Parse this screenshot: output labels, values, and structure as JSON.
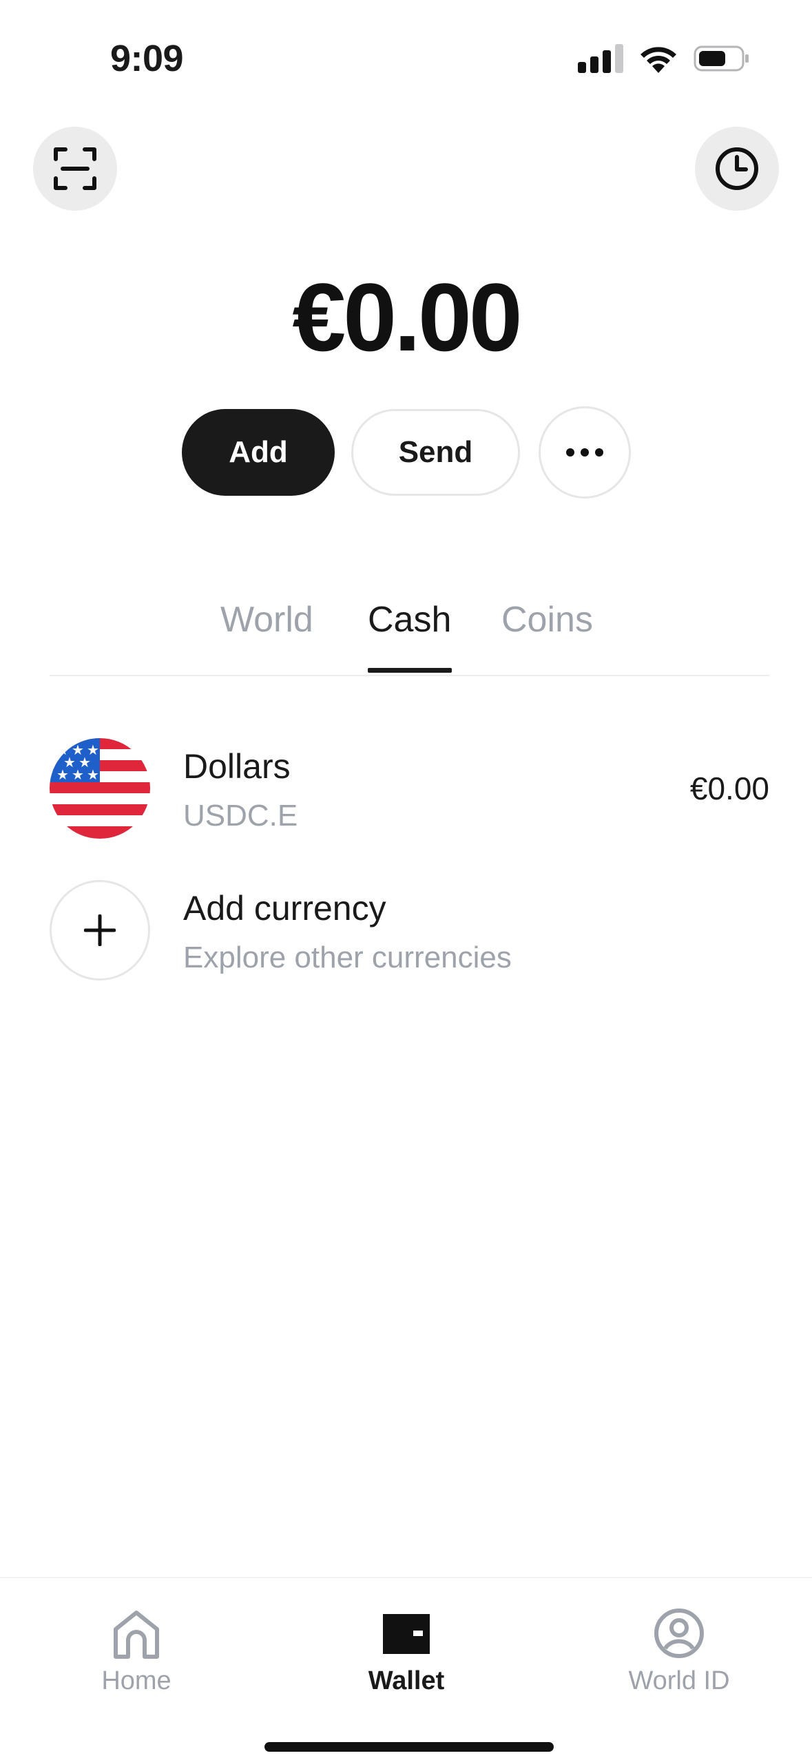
{
  "status_bar": {
    "time": "9:09"
  },
  "header": {
    "scan_icon": "scan-icon",
    "history_icon": "clock-icon"
  },
  "balance": {
    "amount": "€0.00"
  },
  "actions": {
    "add_label": "Add",
    "send_label": "Send",
    "more_icon": "more-dots-icon"
  },
  "tabs": [
    {
      "label": "World",
      "active": false
    },
    {
      "label": "Cash",
      "active": true
    },
    {
      "label": "Coins",
      "active": false
    }
  ],
  "list": [
    {
      "title": "Dollars",
      "subtitle": "USDC.E",
      "amount": "€0.00",
      "icon": "us-flag-icon"
    },
    {
      "title": "Add currency",
      "subtitle": "Explore other currencies",
      "icon": "plus-icon"
    }
  ],
  "bottom_nav": [
    {
      "label": "Home",
      "icon": "home-icon",
      "active": false
    },
    {
      "label": "Wallet",
      "icon": "wallet-icon",
      "active": true
    },
    {
      "label": "World ID",
      "icon": "user-circle-icon",
      "active": false
    }
  ],
  "colors": {
    "accent": "#1a1a1a",
    "muted": "#9ea3ab",
    "button_bg": "#ececed",
    "flag_red": "#e0263b",
    "flag_blue": "#1f5fc9"
  }
}
